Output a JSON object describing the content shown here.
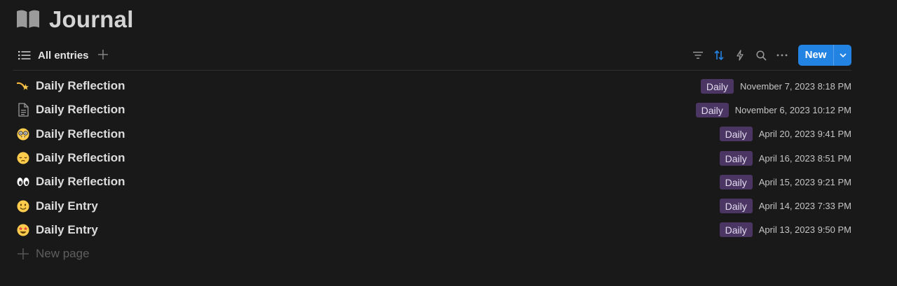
{
  "page": {
    "title": "Journal",
    "icon": "book-icon"
  },
  "view_bar": {
    "view_label": "All entries",
    "view_icon": "list-icon",
    "add_view_icon": "plus-icon",
    "tools": [
      "filter-icon",
      "sort-icon",
      "automation-icon",
      "search-icon",
      "more-icon"
    ],
    "new_button_label": "New",
    "accent_color": "#2383e2"
  },
  "rows": [
    {
      "icon": "shooting-star-emoji",
      "title": "Daily Reflection",
      "tag": "Daily",
      "date": "November 7, 2023 8:18 PM"
    },
    {
      "icon": "page-icon",
      "title": "Daily Reflection",
      "tag": "Daily",
      "date": "November 6, 2023 10:12 PM"
    },
    {
      "icon": "nerd-face-emoji",
      "title": "Daily Reflection",
      "tag": "Daily",
      "date": "April 20, 2023 9:41 PM"
    },
    {
      "icon": "pensive-face-emoji",
      "title": "Daily Reflection",
      "tag": "Daily",
      "date": "April 16, 2023 8:51 PM"
    },
    {
      "icon": "eyes-emoji",
      "title": "Daily Reflection",
      "tag": "Daily",
      "date": "April 15, 2023 9:21 PM"
    },
    {
      "icon": "smiling-face-emoji",
      "title": "Daily Entry",
      "tag": "Daily",
      "date": "April 14, 2023 7:33 PM"
    },
    {
      "icon": "star-struck-emoji",
      "title": "Daily Entry",
      "tag": "Daily",
      "date": "April 13, 2023 9:50 PM"
    }
  ],
  "new_page_label": "New page",
  "tag_color": "#4a3563"
}
